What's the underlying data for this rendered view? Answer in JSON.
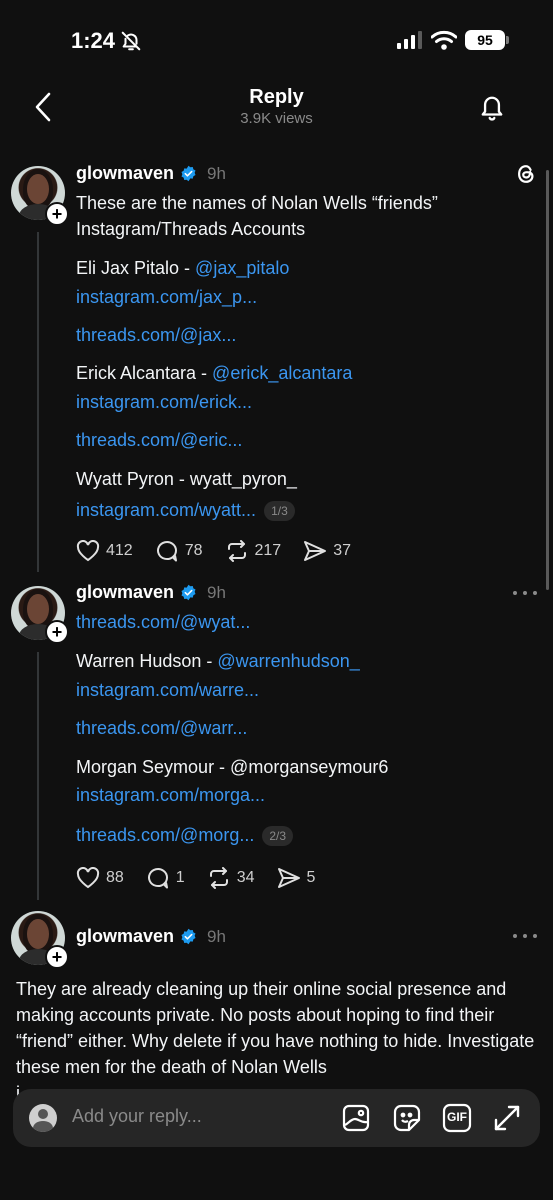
{
  "status_bar": {
    "time": "1:24",
    "battery": "95"
  },
  "header": {
    "title": "Reply",
    "views": "3.9K views"
  },
  "posts": [
    {
      "username": "glowmaven",
      "time": "9h",
      "lines": {
        "l1": "These are the names of Nolan Wells “friends”",
        "l2": "Instagram/Threads Accounts",
        "l3_name": "Eli Jax Pitalo - ",
        "l3_handle": "@jax_pitalo",
        "l4": "instagram.com/jax_p...",
        "l5": "threads.com/@jax...",
        "l6_name": "Erick Alcantara - ",
        "l6_handle": "@erick_alcantara",
        "l7": "instagram.com/erick...",
        "l8": "threads.com/@eric...",
        "l9": "Wyatt Pyron - wyatt_pyron_",
        "l10": "instagram.com/wyatt...",
        "pager": "1/3"
      },
      "likes": "412",
      "replies": "78",
      "reposts": "217",
      "shares": "37"
    },
    {
      "username": "glowmaven",
      "time": "9h",
      "lines": {
        "l1": "threads.com/@wyat...",
        "l2_name": "Warren Hudson - ",
        "l2_handle": "@warrenhudson_",
        "l3": "instagram.com/warre...",
        "l4": "threads.com/@warr...",
        "l5": "Morgan Seymour - @morganseymour6",
        "l6": "instagram.com/morga...",
        "l7": "threads.com/@morg...",
        "pager": "2/3"
      },
      "likes": "88",
      "replies": "1",
      "reposts": "34",
      "shares": "5"
    },
    {
      "username": "glowmaven",
      "time": "9h",
      "body": "They are already cleaning up their online social presence and making accounts private. No posts about hoping to find their “friend” either. Why delete if you have nothing to hide. Investigate these men for the death of Nolan Wells",
      "cut_line": "i"
    }
  ],
  "reply_bar": {
    "placeholder": "Add your reply...",
    "gif_label": "GIF"
  },
  "icons": [
    "bell-slash-icon",
    "signal-icon",
    "wifi-icon",
    "chevron-left-icon",
    "bell-icon",
    "threads-logo-icon",
    "verified-icon",
    "heart-icon",
    "comment-icon",
    "repost-icon",
    "share-icon",
    "more-icon",
    "image-icon",
    "sticker-icon",
    "gif-icon",
    "expand-icon"
  ],
  "colors": {
    "background": "#101010",
    "link": "#3b96f0",
    "verified": "#1d9bf0",
    "muted": "#777777"
  }
}
